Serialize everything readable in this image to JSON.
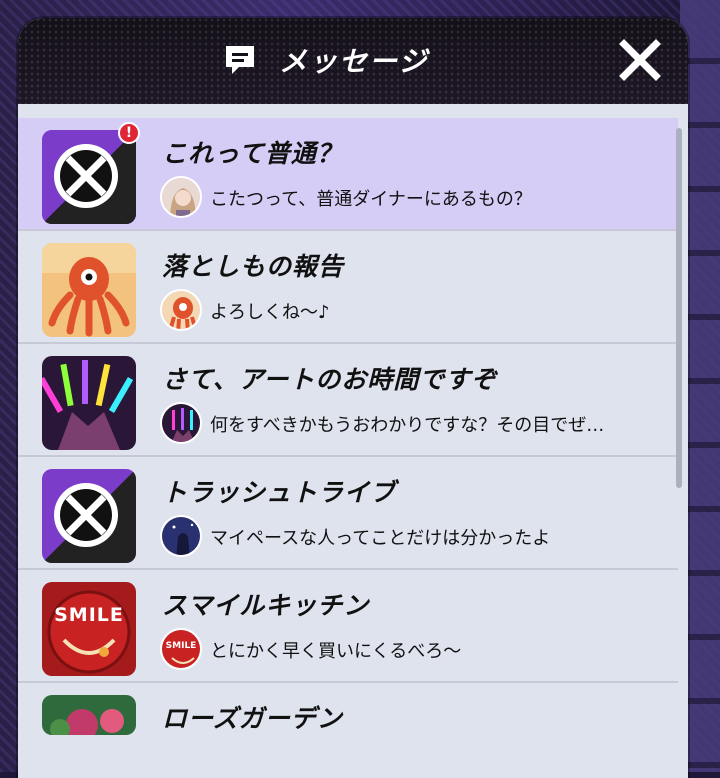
{
  "header": {
    "title": "メッセージ",
    "icon": "chat-bubble-icon",
    "close_icon": "close-icon"
  },
  "messages": [
    {
      "title": "これって普通？",
      "preview": "こたつって、普通ダイナーにあるもの？",
      "unread": true,
      "unread_mark": "!",
      "thumb": "trash-tribe-logo",
      "avatar": "girl-avatar"
    },
    {
      "title": "落としもの報告",
      "preview": "よろしくね～♪",
      "unread": false,
      "thumb": "octopus-character",
      "avatar": "octopus-avatar"
    },
    {
      "title": "さて、アートのお時間ですぞ",
      "preview": "何をすべきかもうおわかりですな？その目でぜ…",
      "unread": false,
      "thumb": "glowstick-hands",
      "avatar": "glowstick-avatar"
    },
    {
      "title": "トラッシュトライブ",
      "preview": "マイペースな人ってことだけは分かったよ",
      "unread": false,
      "thumb": "trash-tribe-logo",
      "avatar": "night-avatar"
    },
    {
      "title": "スマイルキッチン",
      "preview": "とにかく早く買いにくるべろ～",
      "unread": false,
      "thumb": "smile-logo",
      "avatar": "smile-avatar"
    },
    {
      "title": "ローズガーデン",
      "preview": "",
      "unread": false,
      "thumb": "rose-garden",
      "avatar": ""
    }
  ],
  "smile_text": "SMILE",
  "colors": {
    "active_row": "#d6cdf6",
    "row": "#dfe3ee",
    "badge": "#e02636",
    "header": "#141018"
  }
}
